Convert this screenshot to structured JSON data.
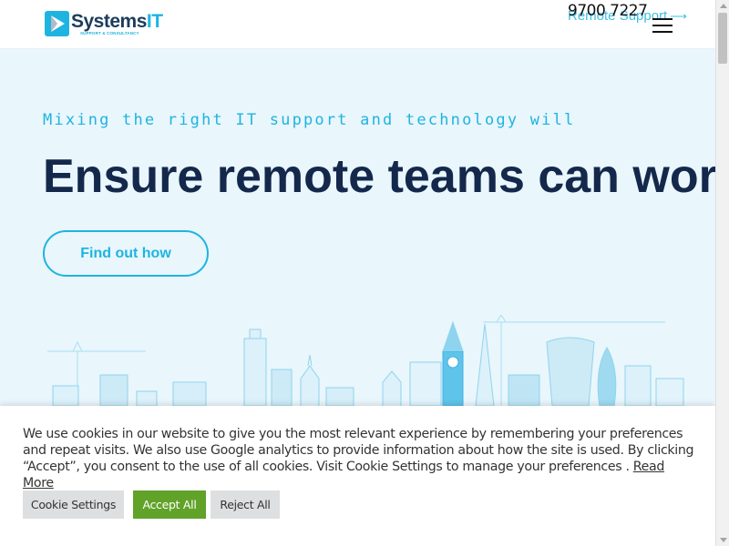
{
  "header": {
    "logo": {
      "name_main": "Systems",
      "name_accent": "IT",
      "tagline": "SUPPORT & CONSULTANCY"
    },
    "phone": "9700 7227",
    "support_link": "Remote Support",
    "support_arrow": "⟶",
    "menu_icon": "hamburger-menu-icon"
  },
  "hero": {
    "kicker": "Mixing the right IT support and technology will",
    "headline": "Ensure remote teams can work e",
    "cta_label": "Find out how",
    "illustration": "city-skyline"
  },
  "cookie_banner": {
    "text": "We use cookies in our website to give you the most relevant experience by remembering your preferences and repeat visits. We also use Google analytics to provide information about how the site is used. By clicking “Accept”, you consent to the use of all cookies. Visit Cookie Settings to manage your preferences .",
    "read_more": "Read More",
    "buttons": {
      "settings": "Cookie Settings",
      "accept": "Accept All",
      "reject": "Reject All"
    }
  },
  "colors": {
    "accent": "#1eb4e0",
    "navy": "#14284b",
    "hero_bg": "#e9f6fc",
    "accept_green": "#61a229"
  }
}
